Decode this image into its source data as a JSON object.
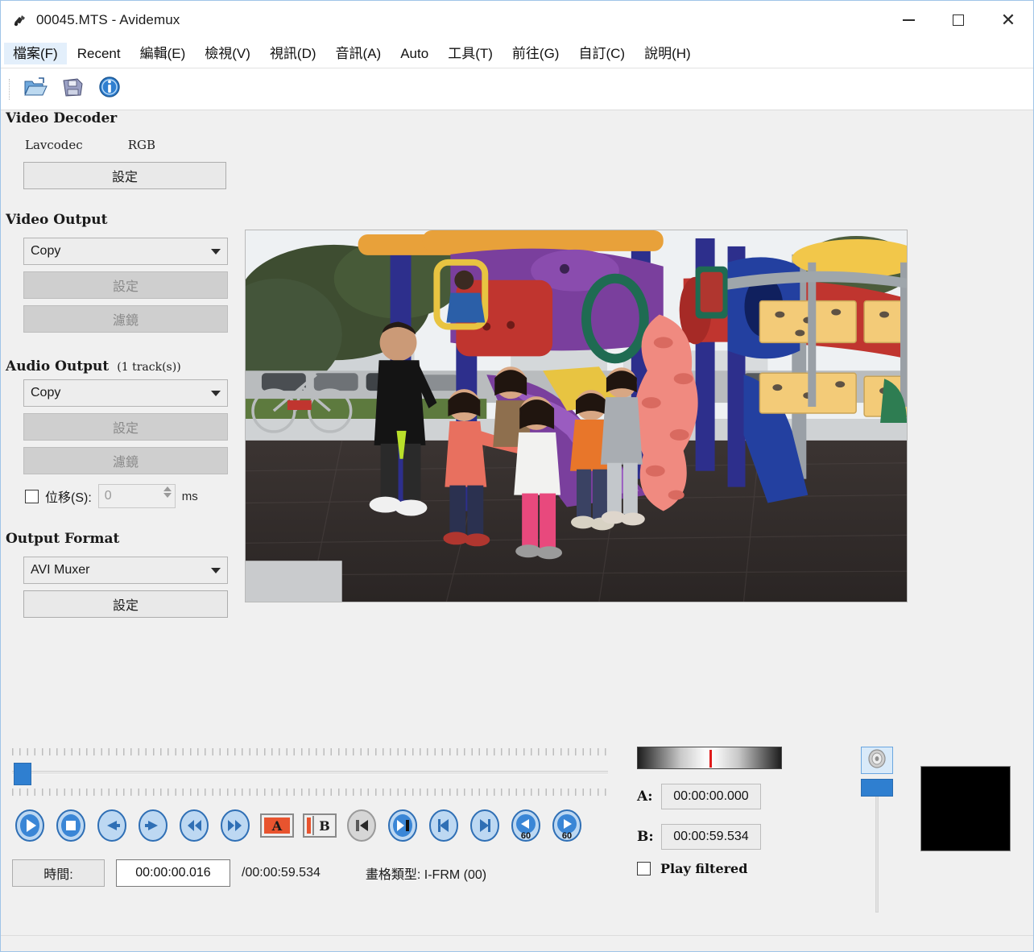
{
  "window": {
    "title": "00045.MTS - Avidemux",
    "app_icon": "avidemux-icon",
    "minimize": "–",
    "maximize": "□",
    "close": "✕"
  },
  "menubar": [
    {
      "label": "檔案(F)",
      "name": "menu-file",
      "active": true
    },
    {
      "label": "Recent",
      "name": "menu-recent",
      "active": false
    },
    {
      "label": "編輯(E)",
      "name": "menu-edit",
      "active": false
    },
    {
      "label": "檢視(V)",
      "name": "menu-view",
      "active": false
    },
    {
      "label": "視訊(D)",
      "name": "menu-video",
      "active": false
    },
    {
      "label": "音訊(A)",
      "name": "menu-audio",
      "active": false
    },
    {
      "label": "Auto",
      "name": "menu-auto",
      "active": false
    },
    {
      "label": "工具(T)",
      "name": "menu-tools",
      "active": false
    },
    {
      "label": "前往(G)",
      "name": "menu-goto",
      "active": false
    },
    {
      "label": "自訂(C)",
      "name": "menu-custom",
      "active": false
    },
    {
      "label": "說明(H)",
      "name": "menu-help",
      "active": false
    }
  ],
  "toolbar": {
    "open_icon": "open-folder-icon",
    "save_icon": "save-floppy-icon",
    "info_icon": "info-icon"
  },
  "video_decoder": {
    "heading": "Video Decoder",
    "codec": "Lavcodec",
    "colorspace": "RGB",
    "configure_label": "設定"
  },
  "video_output": {
    "heading": "Video Output",
    "selected": "Copy",
    "configure_label": "設定",
    "filters_label": "濾鏡"
  },
  "audio_output": {
    "heading": "Audio Output",
    "track_count": "(1 track(s))",
    "selected": "Copy",
    "configure_label": "設定",
    "filters_label": "濾鏡",
    "shift_label": "位移(S):",
    "shift_value": "0",
    "shift_unit": "ms"
  },
  "output_format": {
    "heading": "Output Format",
    "selected": "AVI Muxer",
    "configure_label": "設定"
  },
  "transport": [
    {
      "name": "play-button",
      "icon": "play-icon"
    },
    {
      "name": "stop-button",
      "icon": "stop-icon"
    },
    {
      "name": "previous-frame-button",
      "icon": "arrow-left-icon"
    },
    {
      "name": "next-frame-button",
      "icon": "arrow-right-icon"
    },
    {
      "name": "rewind-button",
      "icon": "double-arrow-left-icon"
    },
    {
      "name": "forward-button",
      "icon": "double-arrow-right-icon"
    },
    {
      "name": "mark-a-button",
      "icon": "mark-a-icon",
      "label": "A"
    },
    {
      "name": "mark-b-button",
      "icon": "mark-b-icon",
      "label": "B"
    },
    {
      "name": "previous-keyframe-button",
      "icon": "prev-keyframe-icon"
    },
    {
      "name": "next-keyframe-button",
      "icon": "next-keyframe-icon"
    },
    {
      "name": "previous-black-frame-button",
      "icon": "skip-back-icon"
    },
    {
      "name": "next-black-frame-button",
      "icon": "skip-forward-icon"
    },
    {
      "name": "back-60s-button",
      "icon": "back-60s-icon",
      "label": "60"
    },
    {
      "name": "forward-60s-button",
      "icon": "forward-60s-icon",
      "label": "60"
    }
  ],
  "status": {
    "time_button_label": "時間:",
    "current_time": "00:00:00.016",
    "total_time": "/00:00:59.534",
    "frame_type_label": "畫格類型: I-FRM (00)"
  },
  "markers": {
    "a_label": "A:",
    "a_value": "00:00:00.000",
    "b_label": "B:",
    "b_value": "00:00:59.534",
    "play_filtered_label": "Play filtered",
    "play_filtered_checked": false
  },
  "volume": {
    "icon": "speaker-icon",
    "level_percent": 100
  },
  "preview": {
    "description": "playground scene with children and adult",
    "colors": {
      "sky": "#eef1f3",
      "tree": "#3d4c30",
      "structure_purple": "#7a3f9d",
      "structure_blue": "#2b2f8f",
      "tube_red": "#c0352f",
      "climb_pink": "#f08a80",
      "panel_yellow": "#f3cb78",
      "ground": "#35302f"
    }
  },
  "theme": {
    "accent": "#2f7fd0",
    "window_bg": "#f0f0f0",
    "marker_red": "#e01b1b"
  }
}
